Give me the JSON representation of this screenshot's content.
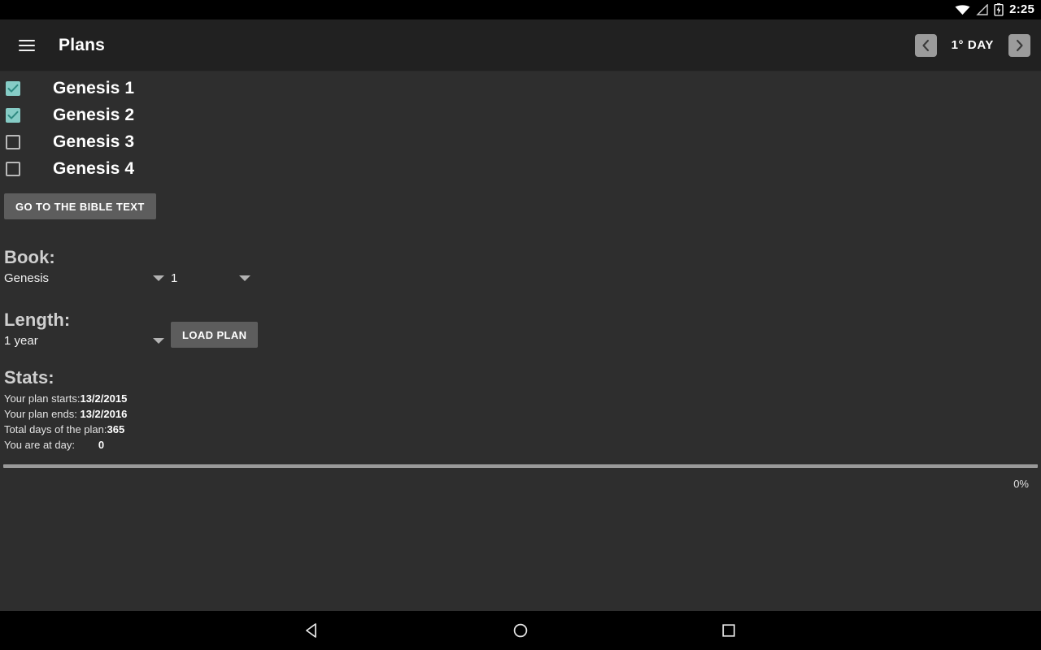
{
  "status_bar": {
    "time": "2:25",
    "icons": [
      "wifi-icon",
      "signal-icon",
      "battery-charging-icon"
    ]
  },
  "app_bar": {
    "menu_icon": "hamburger-menu-icon",
    "title": "Plans",
    "prev_icon": "chevron-left-icon",
    "next_icon": "chevron-right-icon",
    "day_label": "1° DAY"
  },
  "chapters": [
    {
      "label": "Genesis 1",
      "checked": true
    },
    {
      "label": "Genesis 2",
      "checked": true
    },
    {
      "label": "Genesis 3",
      "checked": false
    },
    {
      "label": "Genesis 4",
      "checked": false
    }
  ],
  "bible_text_button": "GO TO THE BIBLE TEXT",
  "book_section": {
    "title": "Book:",
    "book_value": "Genesis",
    "chapter_value": "1"
  },
  "length_section": {
    "title": "Length:",
    "length_value": "1 year",
    "load_plan_button": "LOAD PLAN"
  },
  "stats_section": {
    "title": "Stats:",
    "rows": [
      {
        "label": "Your plan starts:",
        "value": "13/2/2015"
      },
      {
        "label": "Your plan ends: ",
        "value": "13/2/2016"
      },
      {
        "label": "Total days of the plan:",
        "value": "365"
      },
      {
        "label": "You are at day:        ",
        "value": "0"
      }
    ]
  },
  "progress": {
    "percent_label": "0%",
    "percent_value": 0
  },
  "navigation_bar": {
    "back_icon": "back-triangle-icon",
    "home_icon": "home-circle-icon",
    "recents_icon": "recents-square-icon"
  },
  "colors": {
    "accent_teal": "#86ccc6",
    "app_bar": "#212121",
    "content_bg": "#2e2e2e",
    "button_gray": "#5d5d5d"
  }
}
